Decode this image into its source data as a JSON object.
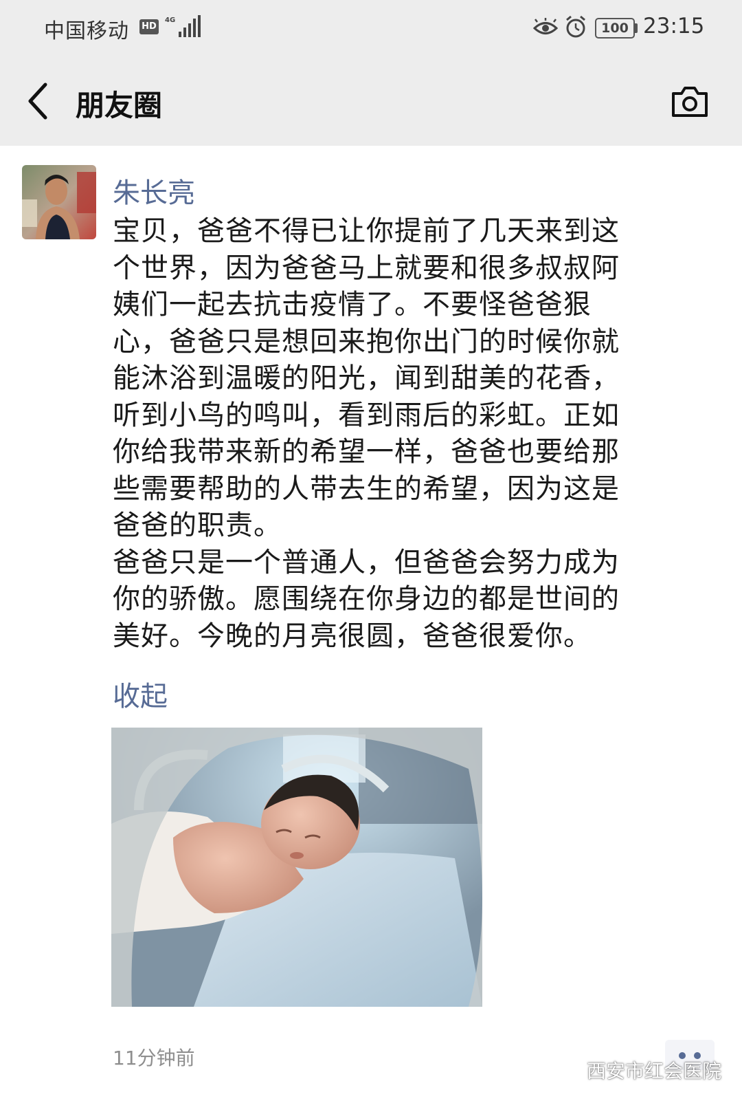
{
  "status_bar": {
    "carrier": "中国移动",
    "hd_label": "HD",
    "network_label": "4G",
    "battery": "100",
    "time": "23:15"
  },
  "nav": {
    "title": "朋友圈",
    "back_icon": "chevron-left-icon",
    "camera_icon": "camera-icon"
  },
  "post": {
    "author": "朱长亮",
    "text": "宝贝，爸爸不得已让你提前了几天来到这\n个世界，因为爸爸马上就要和很多叔叔阿\n姨们一起去抗击疫情了。不要怪爸爸狠\n心，爸爸只是想回来抱你出门的时候你就\n能沐浴到温暖的阳光，闻到甜美的花香，\n听到小鸟的鸣叫，看到雨后的彩虹。正如\n你给我带来新的希望一样，爸爸也要给那\n些需要帮助的人带去生的希望，因为这是\n爸爸的职责。\n爸爸只是一个普通人，但爸爸会努力成为\n你的骄傲。愿围绕在你身边的都是世间的\n美好。今晚的月亮很圆，爸爸很爱你。",
    "collapse_label": "收起",
    "timestamp": "11分钟前"
  },
  "watermark": {
    "text": "西安市红会医院"
  },
  "colors": {
    "link": "#576b95",
    "header_bg": "#ededed"
  }
}
